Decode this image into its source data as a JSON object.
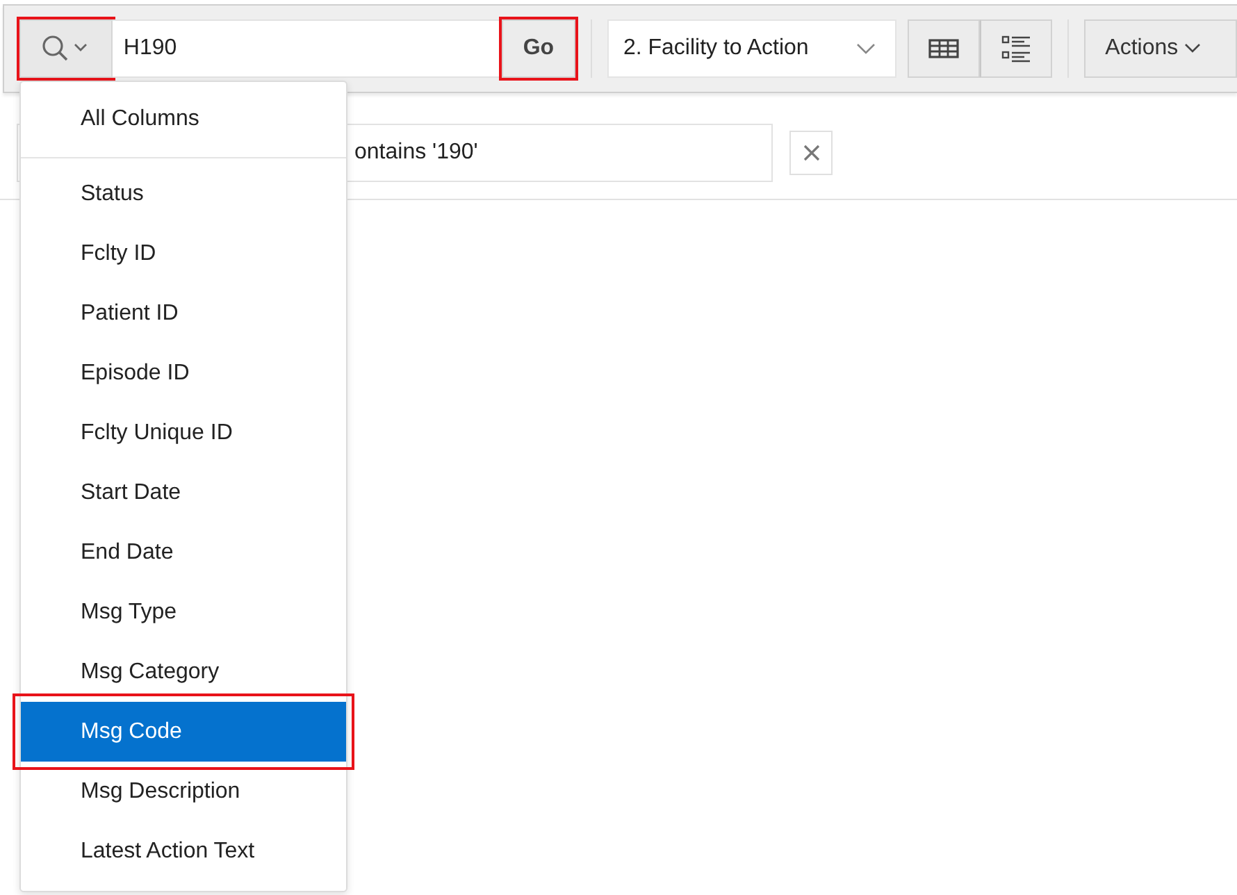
{
  "toolbar": {
    "search_button": {
      "highlighted": true
    },
    "search_field": {
      "value": "H190"
    },
    "go_button": {
      "label": "Go",
      "highlighted": true
    },
    "report_select": {
      "value": "2. Facility to Action"
    },
    "view_buttons": [
      {
        "kind": "grid",
        "selected": false
      },
      {
        "kind": "detail",
        "selected": false
      }
    ],
    "actions_button": {
      "label": "Actions"
    }
  },
  "filter": {
    "text": "ontains '190'"
  },
  "column_menu": {
    "items": [
      {
        "label": "All Columns",
        "selected": false,
        "highlighted": false
      },
      {
        "label": "Status",
        "selected": false,
        "highlighted": false
      },
      {
        "label": "Fclty ID",
        "selected": false,
        "highlighted": false
      },
      {
        "label": "Patient ID",
        "selected": false,
        "highlighted": false
      },
      {
        "label": "Episode ID",
        "selected": false,
        "highlighted": false
      },
      {
        "label": "Fclty Unique ID",
        "selected": false,
        "highlighted": false
      },
      {
        "label": "Start Date",
        "selected": false,
        "highlighted": false
      },
      {
        "label": "End Date",
        "selected": false,
        "highlighted": false
      },
      {
        "label": "Msg Type",
        "selected": false,
        "highlighted": false
      },
      {
        "label": "Msg Category",
        "selected": false,
        "highlighted": false
      },
      {
        "label": "Msg Code",
        "selected": true,
        "highlighted": true
      },
      {
        "label": "Msg Description",
        "selected": false,
        "highlighted": false
      },
      {
        "label": "Latest Action Text",
        "selected": false,
        "highlighted": false
      }
    ]
  }
}
